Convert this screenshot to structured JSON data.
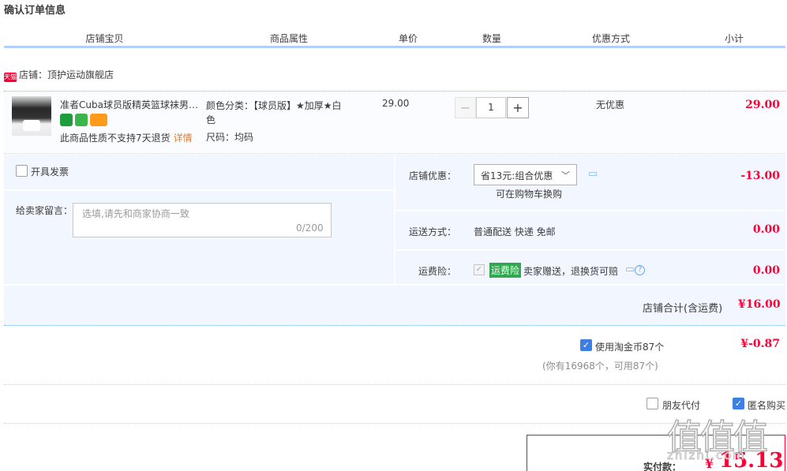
{
  "page": {
    "title": "确认订单信息"
  },
  "columns": [
    "店铺宝贝",
    "商品属性",
    "单价",
    "数量",
    "优惠方式",
    "小计"
  ],
  "shop": {
    "badge": "天猫",
    "label": "店铺：顶护运动旗舰店"
  },
  "item": {
    "title": "准者Cuba球员版精英篮球袜男款中筒毛巾底",
    "no_return_text": "此商品性质不支持7天退货",
    "detail_link": "详情",
    "attr_color": "颜色分类：【球员版】★加厚★白色",
    "attr_size": "尺码：均码",
    "price": "29.00",
    "quantity": "1",
    "qty_minus": "−",
    "qty_plus": "+",
    "promo": "无优惠",
    "subtotal": "29.00"
  },
  "order_options": {
    "invoice_label": "开具发票",
    "message_label": "给卖家留言：",
    "message_placeholder": "选填,请先和商家协商一致",
    "message_count": "0/200",
    "shop_discount_label": "店铺优惠：",
    "shop_discount_select": "省13元:组合优惠",
    "shop_discount_note": "可在购物车换购",
    "shop_discount_value": "-13.00",
    "shipping_label": "运送方式：",
    "shipping_method": "普通配送 快递 免邮",
    "shipping_value": "0.00",
    "insurance_label": "运费险：",
    "insurance_tag": "运费险",
    "insurance_text": "卖家赠送，退换货可赔",
    "insurance_value": "0.00",
    "shop_total_label": "店铺合计(含运费)",
    "shop_total_value": "¥16.00"
  },
  "coins": {
    "label": "使用淘金币87个",
    "value": "¥-0.87",
    "note": "(你有16968个，可用87个)"
  },
  "checkout": {
    "friend_pay_label": "朋友代付",
    "anonymous_label": "匿名购买",
    "pay_label": "实付款：",
    "pay_currency": "¥",
    "pay_amount": "15.13"
  },
  "watermark": {
    "glyphs": "值值值",
    "site": "zhizhi.com"
  },
  "colors": {
    "accent_red": "#ff0036",
    "header_line": "#b2d1ff",
    "panel_bg": "#f2f7ff",
    "checkbox_blue": "#3d7fe3"
  },
  "icons": [
    "tmall-icon",
    "chat-icon",
    "help-icon",
    "chevron-down-icon",
    "check-icon"
  ]
}
